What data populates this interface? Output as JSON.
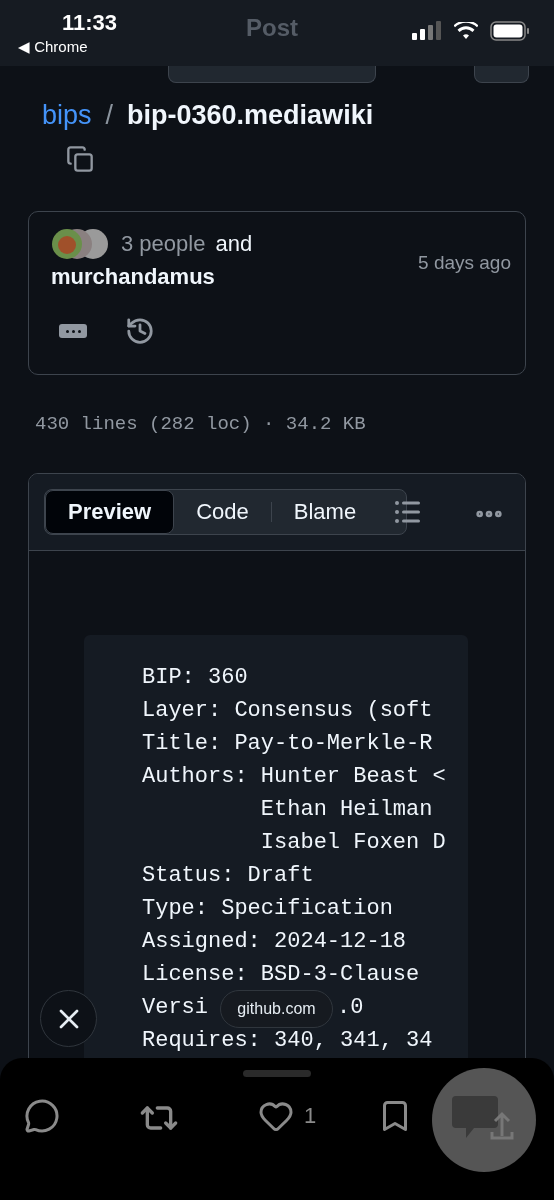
{
  "status_bar": {
    "time": "11:33",
    "back_app": "◀ Chrome",
    "nav_title": "Post"
  },
  "breadcrumb": {
    "repo": "bips",
    "separator": "/",
    "file": "bip-0360.mediawiki"
  },
  "commit": {
    "people": "3 people",
    "joiner": "and",
    "author": "murchandamus",
    "time": "5 days ago"
  },
  "file_info": "430 lines (282 loc) · 34.2 KB",
  "view_tabs": [
    {
      "label": "Preview",
      "selected": true
    },
    {
      "label": "Code",
      "selected": false
    },
    {
      "label": "Blame",
      "selected": false
    }
  ],
  "code_lines": [
    {
      "kind": "text",
      "text": "BIP: 360"
    },
    {
      "kind": "text",
      "text": "Layer: Consensus (soft"
    },
    {
      "kind": "text",
      "text": "Title: Pay-to-Merkle-R"
    },
    {
      "kind": "text",
      "text": "Authors: Hunter Beast <"
    },
    {
      "kind": "text",
      "text": "         Ethan Heilman"
    },
    {
      "kind": "text",
      "text": "         Isabel Foxen D"
    },
    {
      "kind": "text",
      "text": "Status: Draft"
    },
    {
      "kind": "text",
      "text": "Type: Specification"
    },
    {
      "kind": "text",
      "text": "Assigned: 2024-12-18"
    },
    {
      "kind": "text",
      "text": "License: BSD-3-Clause"
    },
    {
      "kind": "covered",
      "before": "Versi",
      "after": ".0"
    },
    {
      "kind": "text",
      "text": "Requires: 340, 341, 34"
    }
  ],
  "link_pill": "github.com",
  "actions": {
    "likes": "1"
  }
}
